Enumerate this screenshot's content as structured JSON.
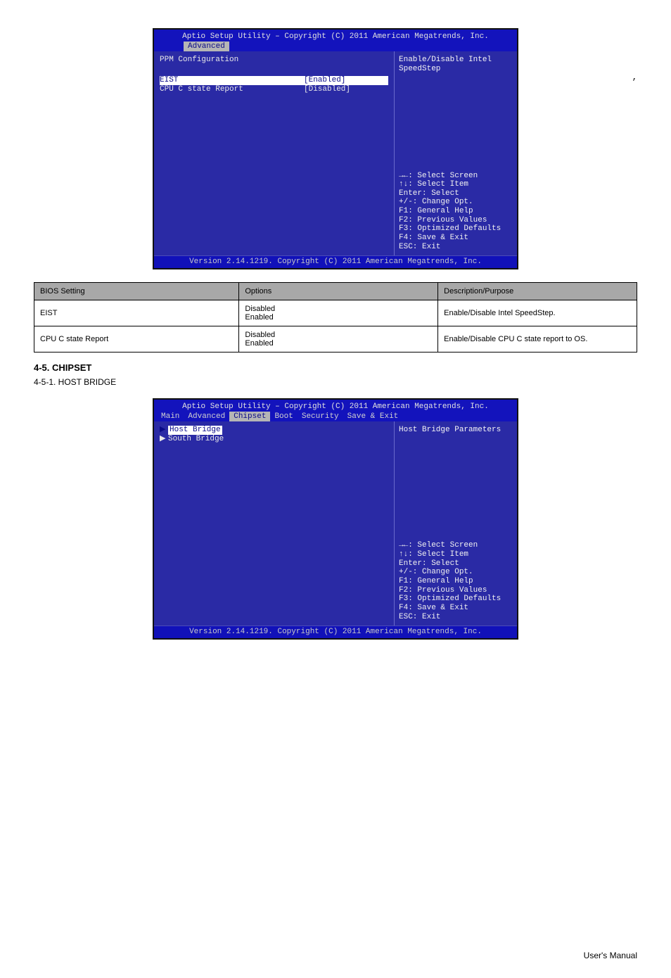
{
  "page": {
    "top_right_marker": ",",
    "footer_right": "User's Manual",
    "footer_left": ""
  },
  "bios_common": {
    "title": "Aptio Setup Utility – Copyright (C) 2011 American Megatrends, Inc.",
    "footer": "Version 2.14.1219. Copyright (C) 2011 American Megatrends, Inc.",
    "keys": {
      "l1": "→←: Select Screen",
      "l2": "↑↓: Select Item",
      "l3": "Enter: Select",
      "l4": "+/-: Change Opt.",
      "l5": "F1: General Help",
      "l6": "F2: Previous Values",
      "l7": "F3: Optimized Defaults",
      "l8": "F4: Save & Exit",
      "l9": "ESC: Exit"
    }
  },
  "screen1": {
    "active_tab": "Advanced",
    "section_title": "PPM Configuration",
    "help": "Enable/Disable Intel SpeedStep",
    "rows": [
      {
        "label": "EIST",
        "value": "[Enabled]",
        "selected": true
      },
      {
        "label": "CPU C state Report",
        "value": "[Disabled]",
        "selected": false
      }
    ]
  },
  "table1": {
    "headers": [
      "BIOS Setting",
      "Options",
      "Description/Purpose"
    ],
    "rows": [
      {
        "c0": "EIST",
        "c1": "Disabled\nEnabled",
        "c2": "Enable/Disable Intel SpeedStep."
      },
      {
        "c0": "CPU C state Report",
        "c1": "Disabled\nEnabled",
        "c2": "Enable/Disable CPU C state report to OS."
      }
    ]
  },
  "section_heading": {
    "num": "4-5. CHIPSET",
    "sub": "4-5-1. HOST BRIDGE"
  },
  "screen2": {
    "tabs": [
      "Main",
      "Advanced",
      "Chipset",
      "Boot",
      "Security",
      "Save & Exit"
    ],
    "active_tab_index": 2,
    "items": [
      {
        "label": "Host Bridge",
        "selected": true
      },
      {
        "label": "South Bridge",
        "selected": false
      }
    ],
    "help": "Host Bridge Parameters"
  }
}
